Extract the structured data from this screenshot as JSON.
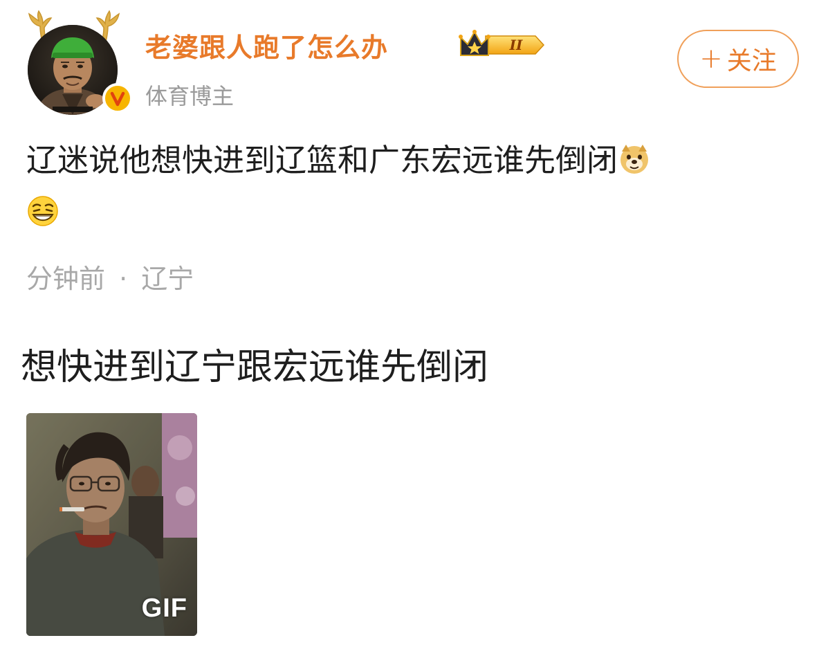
{
  "header": {
    "username": "老婆跟人跑了怎么办",
    "role": "体育博主",
    "vip_level": "II",
    "verify_mark": "V",
    "follow_plus": "+",
    "follow_label": "关注"
  },
  "post": {
    "text": "辽迷说他想快进到辽篮和广东宏远谁先倒闭",
    "emoji_1": "doge-emoji",
    "emoji_2": "smirk-grin-emoji",
    "meta_time": "分钟前",
    "meta_sep": "·",
    "meta_location": "辽宁"
  },
  "reply": {
    "text": "想快进到辽宁跟宏远谁先倒闭",
    "gif_label": "GIF"
  },
  "colors": {
    "username": "#e87a2a",
    "follow_border": "#f0a05a",
    "meta_gray": "#a8a8a8",
    "badge_gold": "#f7b500"
  }
}
